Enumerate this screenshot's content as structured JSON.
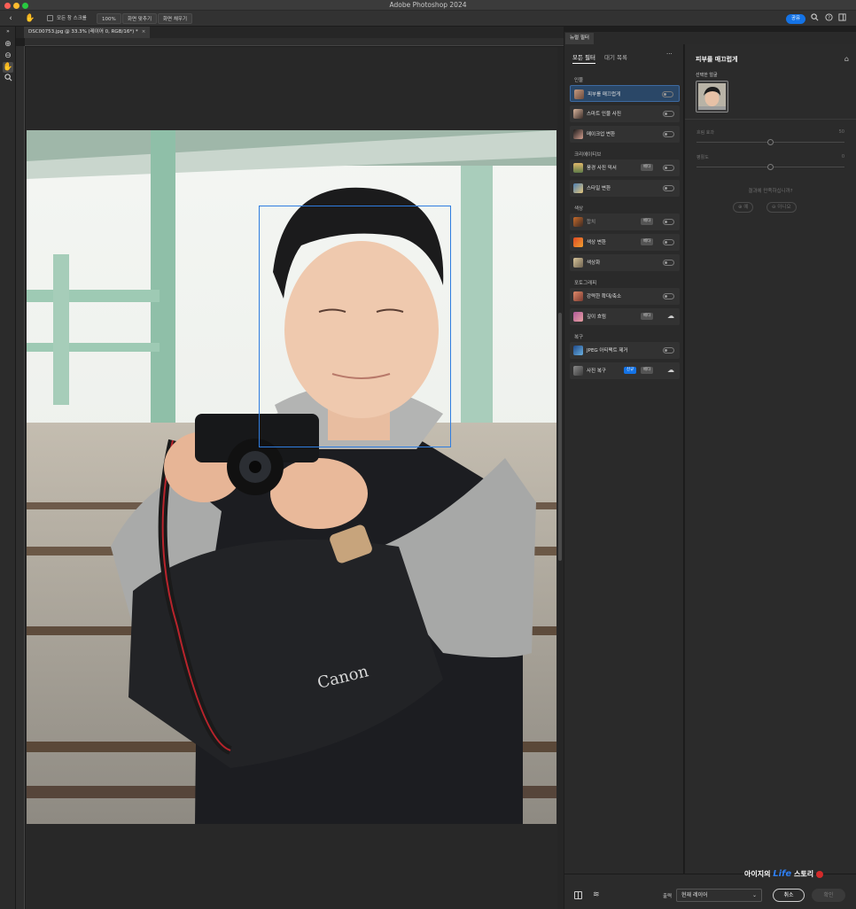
{
  "app": {
    "title": "Adobe Photoshop 2024"
  },
  "options_bar": {
    "scroll_all_windows": "모든 창 스크롤",
    "zoom_100": "100%",
    "fit_screen": "화면 맞추기",
    "fill_screen": "화면 채우기",
    "share": "공유"
  },
  "document": {
    "tab_title": "DSC00753.jpg @ 33.3% (레이어 0, RGB/16*) *"
  },
  "neural_filters": {
    "panel_tab": "뉴럴 필터",
    "tabs": [
      "모든 필터",
      "대기 목록"
    ],
    "more": "···",
    "categories": [
      {
        "name": "인물",
        "items": [
          {
            "label": "피부를 매끄럽게",
            "selected": true,
            "control": "toggle"
          },
          {
            "label": "스마트 인물 사진",
            "control": "toggle"
          },
          {
            "label": "메이크업 변환",
            "control": "toggle"
          }
        ]
      },
      {
        "name": "크리에이티브",
        "items": [
          {
            "label": "풍경 사진 믹서",
            "badge": "베타",
            "control": "toggle"
          },
          {
            "label": "스타일 변환",
            "control": "toggle"
          }
        ]
      },
      {
        "name": "색상",
        "items": [
          {
            "label": "합치",
            "badge": "베타",
            "control": "toggle",
            "dim": true
          },
          {
            "label": "색상 변환",
            "badge": "베타",
            "control": "toggle"
          },
          {
            "label": "색상화",
            "control": "toggle"
          }
        ]
      },
      {
        "name": "포토그래피",
        "items": [
          {
            "label": "강력한 확대/축소",
            "control": "toggle"
          },
          {
            "label": "깊이 흐림",
            "badge": "베타",
            "control": "cloud"
          }
        ]
      },
      {
        "name": "복구",
        "items": [
          {
            "label": "JPEG 아티팩트 제거",
            "control": "toggle"
          },
          {
            "label": "사진 복구",
            "badge_new": "신규",
            "badge": "베타",
            "control": "cloud"
          }
        ]
      }
    ],
    "detail": {
      "title": "피부를 매끄럽게",
      "selected_face_label": "선택한 얼굴",
      "sliders": [
        {
          "label": "흐림 효과",
          "value": "50",
          "fraction": 0.5
        },
        {
          "label": "평활도",
          "value": "0",
          "fraction": 0.5
        }
      ],
      "feedback_question": "결과에 만족하십니까?",
      "yes": "예",
      "no": "아니요"
    }
  },
  "bottom_bar": {
    "output_label": "출력",
    "output_value": "현재 레이어",
    "cancel": "취소",
    "ok": "확인"
  },
  "watermark": {
    "prefix": "아이지의",
    "life": "Life",
    "suffix": "스토리"
  },
  "colors": {
    "accent": "#1473e6",
    "face_box": "#2f7de0",
    "selected_item": "#2a4767"
  }
}
